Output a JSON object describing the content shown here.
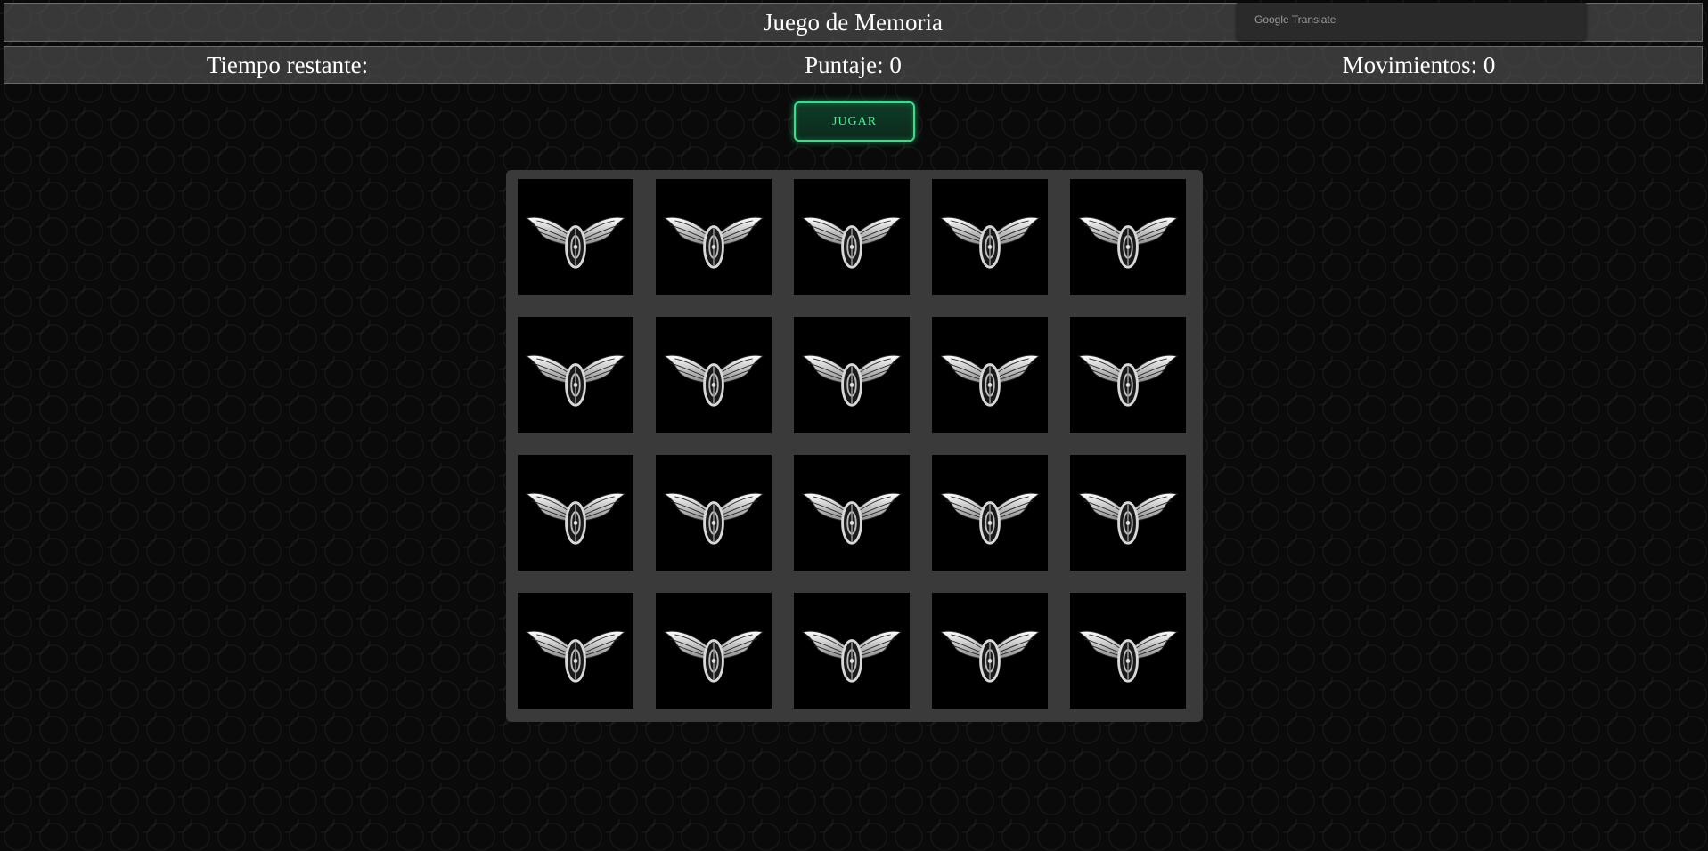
{
  "header": {
    "title": "Juego de Memoria"
  },
  "translate": {
    "label": "Google Translate"
  },
  "stats": {
    "time_label": "Tiempo restante:",
    "score_label": "Puntaje: 0",
    "moves_label": "Movimientos: 0"
  },
  "controls": {
    "play_label": "JUGAR"
  },
  "board": {
    "rows": 4,
    "cols": 5,
    "card_back_icon": "winged-wheel-icon"
  },
  "colors": {
    "accent": "#2fe38a",
    "background": "#0a0a0a",
    "bar": "#5f5f5f",
    "board": "#3a3a3a"
  }
}
